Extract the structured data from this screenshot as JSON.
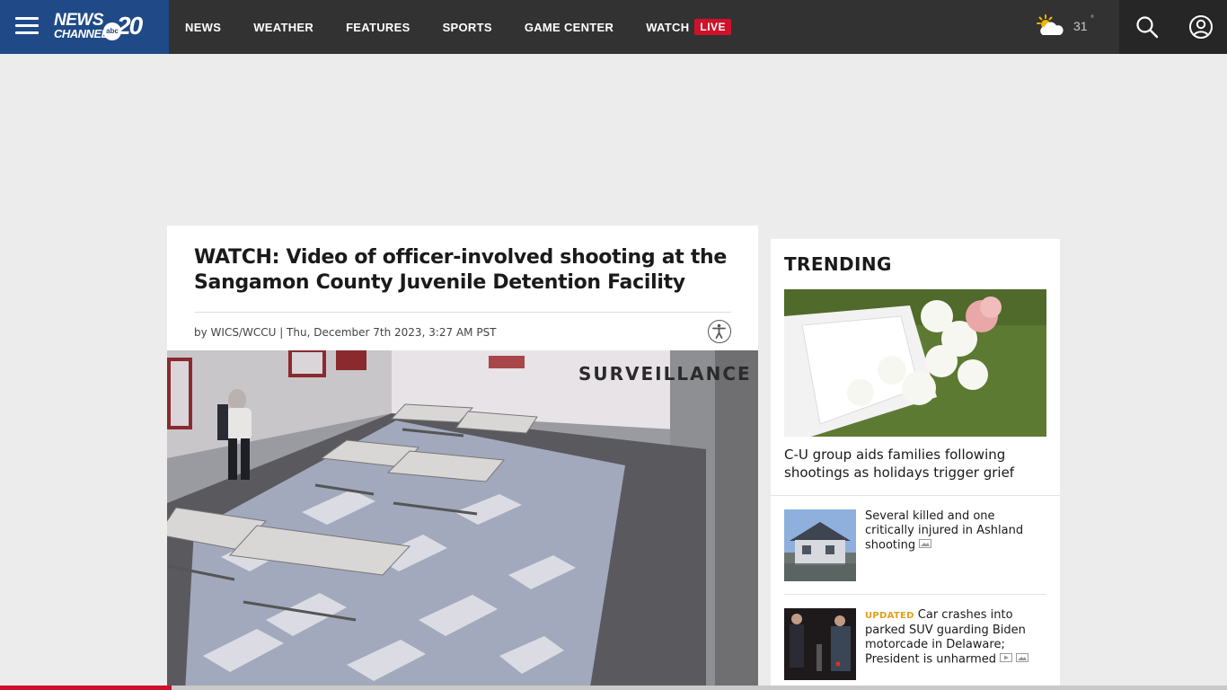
{
  "brand": {
    "logo_line1": "NEWS",
    "logo_line2": "CHANNEL",
    "logo_network": "abc",
    "logo_number": "20"
  },
  "nav": {
    "items": [
      "NEWS",
      "WEATHER",
      "FEATURES",
      "SPORTS",
      "GAME CENTER"
    ],
    "watch_label": "WATCH",
    "live_badge": "LIVE"
  },
  "weather": {
    "temperature": "31",
    "degree_symbol": "°",
    "icon": "partly-cloudy-icon"
  },
  "icons": {
    "menu": "hamburger-menu-icon",
    "search": "search-icon",
    "account": "account-icon",
    "accessibility": "accessibility-icon"
  },
  "article": {
    "headline": "WATCH: Video of officer-involved shooting at the Sangamon County Juvenile Detention Facility",
    "byline": "by WICS/WCCU | Thu, December 7th 2023, 3:27 AM PST",
    "video_overlay_text": "SURVEILLANCE VID"
  },
  "trending": {
    "title": "TRENDING",
    "hero_caption": "C-U group aids families following shootings as holidays trigger grief",
    "items": [
      {
        "badge": "",
        "text": "Several killed and one critically injured in Ashland shooting",
        "media": [
          "gallery-icon"
        ]
      },
      {
        "badge": "UPDATED",
        "text": "Car crashes into parked SUV guarding Biden motorcade in Delaware; President is unharmed",
        "media": [
          "video-icon",
          "gallery-icon"
        ]
      }
    ]
  },
  "colors": {
    "header_bg": "#323232",
    "brand_bg": "#1f4a87",
    "live_red": "#d0112b",
    "updated_orange": "#e0a01a",
    "page_bg": "#ececec"
  },
  "scroll_progress": 0.14
}
